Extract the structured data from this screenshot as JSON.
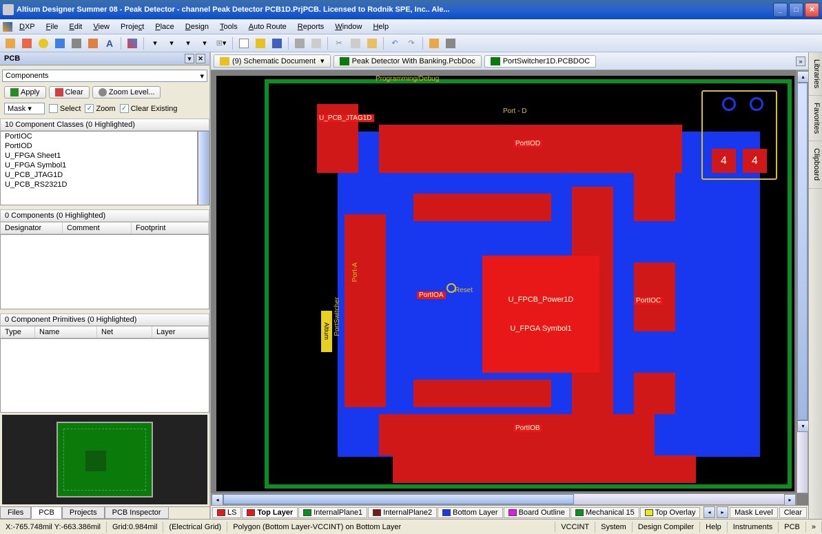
{
  "window": {
    "title": "Altium Designer Summer 08 - Peak Detector - channel Peak Detector PCB1D.PrjPCB. Licensed to Rodnik SPE, Inc.. Ale..."
  },
  "menu": [
    "DXP",
    "File",
    "Edit",
    "View",
    "Project",
    "Place",
    "Design",
    "Tools",
    "Auto Route",
    "Reports",
    "Window",
    "Help"
  ],
  "menu_hotkeys": [
    "D",
    "F",
    "E",
    "V",
    "C",
    "P",
    "D",
    "T",
    "A",
    "R",
    "W",
    "H"
  ],
  "panel": {
    "title": "PCB",
    "dropdown": "Components",
    "apply": "Apply",
    "clear": "Clear",
    "zoom": "Zoom Level...",
    "mask": "Mask",
    "select": "Select",
    "zoom_cb": "Zoom",
    "clear_existing": "Clear Existing",
    "classes_header": "10 Component Classes (0 Highlighted)",
    "class_items": [
      "PortIOC",
      "PortIOD",
      "U_FPGA Sheet1",
      "U_FPGA Symbol1",
      "U_PCB_JTAG1D",
      "U_PCB_RS2321D"
    ],
    "components_header": "0 Components (0 Highlighted)",
    "comp_cols": [
      "Designator",
      "Comment",
      "Footprint"
    ],
    "primitives_header": "0 Component Primitives (0 Highlighted)",
    "prim_cols": [
      "Type",
      "Name",
      "Net",
      "Layer"
    ]
  },
  "bottom_tabs": [
    "Files",
    "PCB",
    "Projects",
    "PCB Inspector"
  ],
  "bottom_active": "PCB",
  "doc_tabs": [
    {
      "label": "(9) Schematic Document",
      "icon": "folder"
    },
    {
      "label": "Peak Detector With Banking.PcbDoc",
      "icon": "pcb"
    },
    {
      "label": "PortSwitcher1D.PCBDOC",
      "icon": "pcb",
      "active": true
    }
  ],
  "pcb": {
    "prog_debug": "Programming/Debug",
    "center_chip_top": "U_FPCB_Power1D",
    "center_chip_bot": "U_FPGA Symbol1",
    "reset": "Reset",
    "port_a": "Port-A",
    "port_d": "Port - D",
    "labels": {
      "jtag": "U_PCB_JTAG1D",
      "portIOA": "PortIOA",
      "portIOB": "PortIOB",
      "portIOC": "PortIOC",
      "portIOD": "PortIOD"
    },
    "altium": "Altium",
    "side_text": "PortSwitcher"
  },
  "layers": [
    {
      "name": "LS",
      "color": "#e81818"
    },
    {
      "name": "Top Layer",
      "color": "#e81818",
      "active": true
    },
    {
      "name": "InternalPlane1",
      "color": "#0a9020"
    },
    {
      "name": "InternalPlane2",
      "color": "#7a1818"
    },
    {
      "name": "Bottom Layer",
      "color": "#1838f0"
    },
    {
      "name": "Board Outline",
      "color": "#e818e8"
    },
    {
      "name": "Mechanical 15",
      "color": "#0a9020"
    },
    {
      "name": "Top Overlay",
      "color": "#e8e820"
    }
  ],
  "layer_extras": {
    "mask_level": "Mask Level",
    "clear": "Clear"
  },
  "status": {
    "coords": "X:-765.748mil Y:-663.386mil",
    "grid": "Grid:0.984mil",
    "grid_type": "(Electrical Grid)",
    "info": "Polygon (Bottom Layer-VCCINT) on Bottom Layer",
    "net": "VCCINT",
    "right": [
      "System",
      "Design Compiler",
      "Help",
      "Instruments",
      "PCB"
    ]
  },
  "right_tabs": [
    "Libraries",
    "Favorites",
    "Clipboard"
  ]
}
